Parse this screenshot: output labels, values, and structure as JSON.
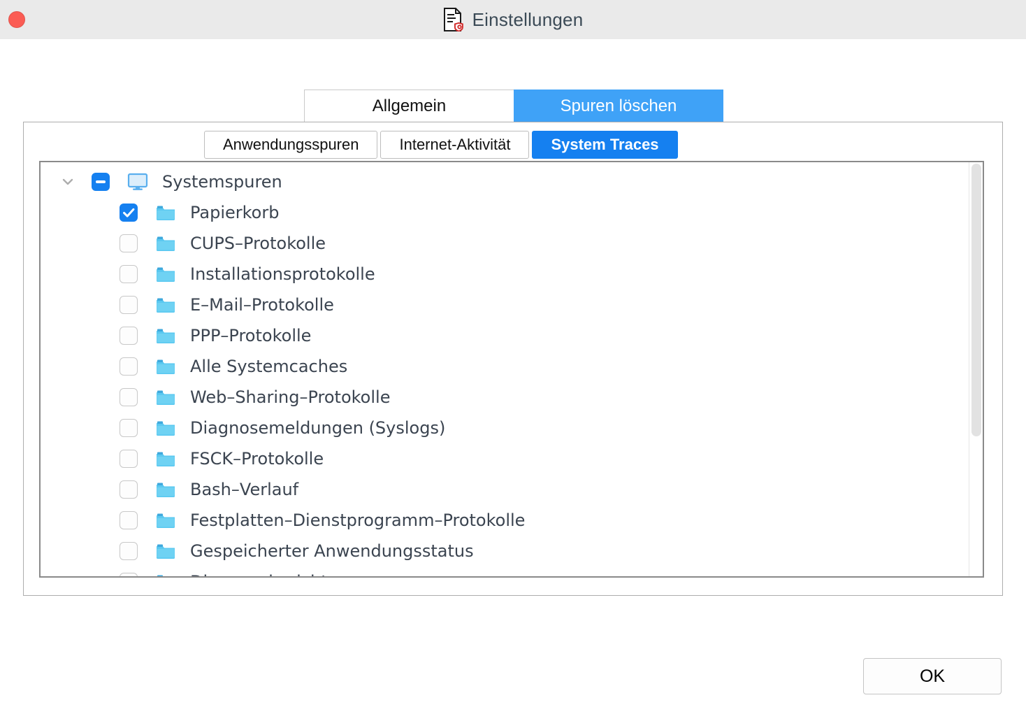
{
  "window": {
    "title": "Einstellungen",
    "title_icon": "document-settings-icon",
    "close_button": "close-window-button"
  },
  "colors": {
    "titlebar_bg": "#eaeaea",
    "tab_selected_outer": "#3fa2f7",
    "tab_selected_inner": "#1580f0",
    "checkbox_accent": "#1580f0",
    "folder_icon": "#5ac8f0",
    "text": "#3b4450",
    "close_button": "#fb5c54"
  },
  "outer_tabs": [
    {
      "label": "Allgemein",
      "selected": false
    },
    {
      "label": "Spuren löschen",
      "selected": true
    }
  ],
  "inner_tabs": [
    {
      "label": "Anwendungsspuren",
      "selected": false
    },
    {
      "label": "Internet-Aktivität",
      "selected": false
    },
    {
      "label": "System Traces",
      "selected": true
    }
  ],
  "tree": {
    "root": {
      "label": "Systemspuren",
      "icon": "monitor-icon",
      "checkbox_state": "indeterminate",
      "expanded": true,
      "chevron": "chevron-down-icon"
    },
    "items": [
      {
        "label": "Papierkorb",
        "icon": "folder-icon",
        "checked": true
      },
      {
        "label": "CUPS–Protokolle",
        "icon": "folder-icon",
        "checked": false
      },
      {
        "label": "Installationsprotokolle",
        "icon": "folder-icon",
        "checked": false
      },
      {
        "label": "E–Mail–Protokolle",
        "icon": "folder-icon",
        "checked": false
      },
      {
        "label": "PPP–Protokolle",
        "icon": "folder-icon",
        "checked": false
      },
      {
        "label": "Alle Systemcaches",
        "icon": "folder-icon",
        "checked": false
      },
      {
        "label": "Web–Sharing–Protokolle",
        "icon": "folder-icon",
        "checked": false
      },
      {
        "label": "Diagnosemeldungen (Syslogs)",
        "icon": "folder-icon",
        "checked": false
      },
      {
        "label": "FSCK–Protokolle",
        "icon": "folder-icon",
        "checked": false
      },
      {
        "label": "Bash–Verlauf",
        "icon": "folder-icon",
        "checked": false
      },
      {
        "label": "Festplatten–Dienstprogramm–Protokolle",
        "icon": "folder-icon",
        "checked": false
      },
      {
        "label": "Gespeicherter Anwendungsstatus",
        "icon": "folder-icon",
        "checked": false
      },
      {
        "label": "Diagnoseberichte",
        "icon": "folder-icon",
        "checked": false
      }
    ]
  },
  "footer": {
    "ok_label": "OK"
  }
}
